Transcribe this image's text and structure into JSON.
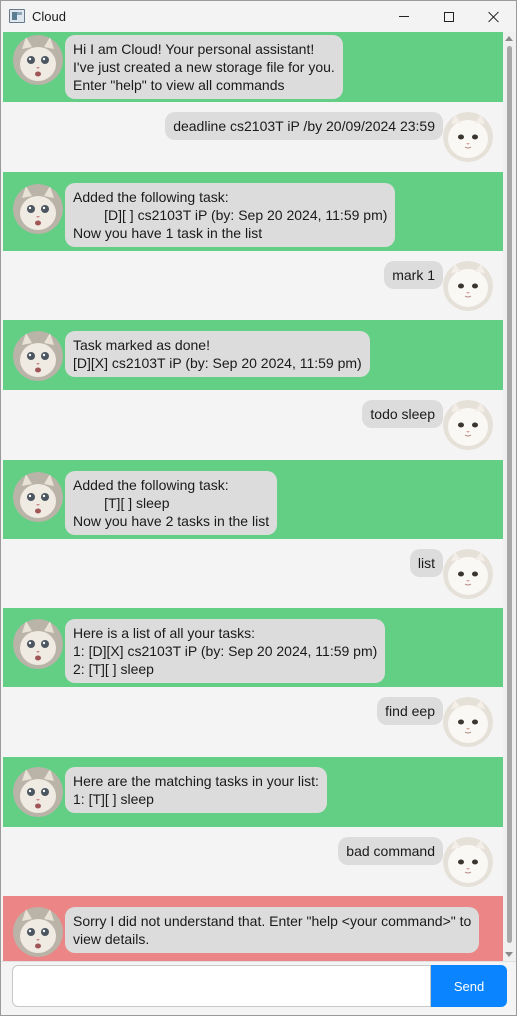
{
  "window": {
    "title": "Cloud"
  },
  "messages": [
    {
      "sender": "bot",
      "variant": "green",
      "text": "Hi I am Cloud! Your personal assistant!\nI've just created a new storage file for you.\nEnter \"help\" to view all commands"
    },
    {
      "sender": "user",
      "text": "deadline cs2103T iP /by 20/09/2024 23:59"
    },
    {
      "sender": "bot",
      "variant": "green",
      "text": "Added the following task:\n        [D][ ] cs2103T iP (by: Sep 20 2024, 11:59 pm)\nNow you have 1 task in the list"
    },
    {
      "sender": "user",
      "text": "mark 1"
    },
    {
      "sender": "bot",
      "variant": "green",
      "text": "Task marked as done!\n[D][X] cs2103T iP (by: Sep 20 2024, 11:59 pm)"
    },
    {
      "sender": "user",
      "text": "todo sleep"
    },
    {
      "sender": "bot",
      "variant": "green",
      "text": "Added the following task:\n        [T][ ] sleep\nNow you have 2 tasks in the list"
    },
    {
      "sender": "user",
      "text": "list"
    },
    {
      "sender": "bot",
      "variant": "green",
      "text": "Here is a list of all your tasks:\n1: [D][X] cs2103T iP (by: Sep 20 2024, 11:59 pm)\n2: [T][ ] sleep"
    },
    {
      "sender": "user",
      "text": "find eep"
    },
    {
      "sender": "bot",
      "variant": "green",
      "text": "Here are the matching tasks in your list:\n1: [T][ ] sleep"
    },
    {
      "sender": "user",
      "text": "bad command"
    },
    {
      "sender": "bot",
      "variant": "red",
      "text": "Sorry I did not understand that. Enter \"help <your command>\" to\nview details."
    }
  ],
  "input": {
    "value": "",
    "placeholder": ""
  },
  "send_button": {
    "label": "Send"
  },
  "colors": {
    "bot_bg": "#63cf84",
    "error_bg": "#ec8585",
    "bubble": "#dcdcdc",
    "send": "#0a84ff"
  }
}
